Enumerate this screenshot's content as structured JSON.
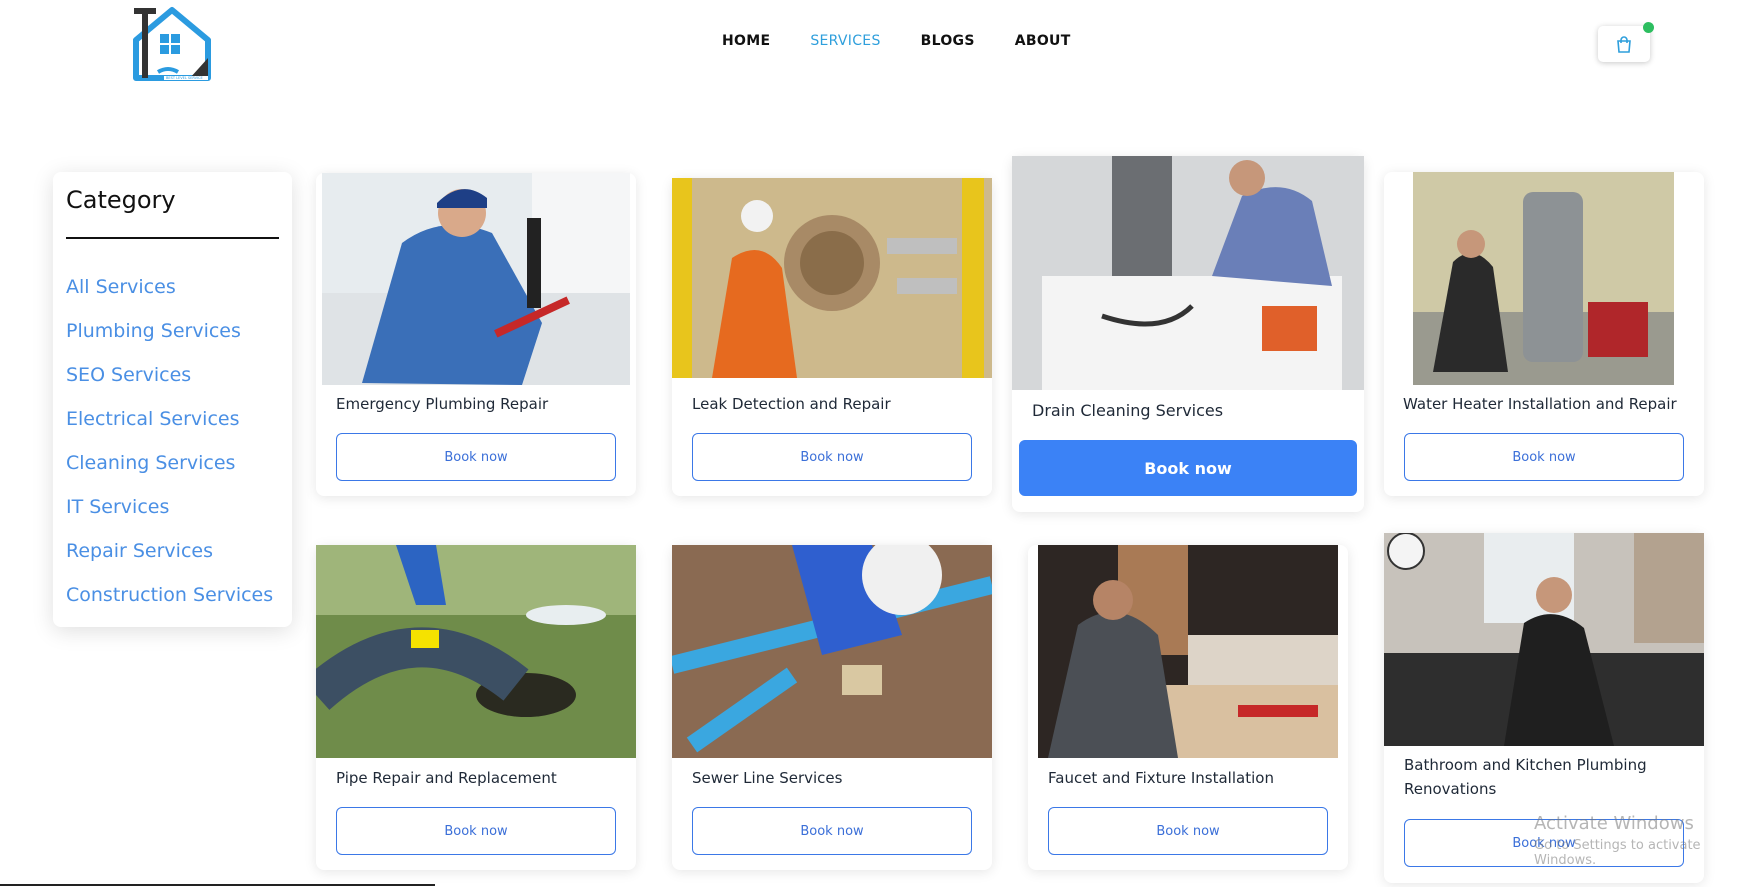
{
  "header": {
    "nav": [
      "HOME",
      "SERVICES",
      "BLOGS",
      "ABOUT"
    ],
    "active_nav": "SERVICES",
    "cart_icon": "shopping-bag-icon",
    "logo_text": "BEST LEVEL SERVICE"
  },
  "sidebar": {
    "title": "Category",
    "items": [
      "All Services",
      "Plumbing Services",
      "SEO Services",
      "Electrical Services",
      "Cleaning Services",
      "IT Services",
      "Repair Services",
      "Construction Services"
    ]
  },
  "services": [
    {
      "title": "Emergency Plumbing Repair",
      "button": "Book now"
    },
    {
      "title": "Leak Detection and Repair",
      "button": "Book now"
    },
    {
      "title": "Drain Cleaning Services",
      "button": "Book now"
    },
    {
      "title": "Water Heater Installation and Repair",
      "button": "Book now"
    },
    {
      "title": "Pipe Repair and Replacement",
      "button": "Book now"
    },
    {
      "title": "Sewer Line Services",
      "button": "Book now"
    },
    {
      "title": "Faucet and Fixture Installation",
      "button": "Book now"
    },
    {
      "title": "Bathroom and Kitchen Plumbing Renovations",
      "button": "Book now"
    }
  ],
  "watermark": {
    "line1": "Activate Windows",
    "line2": "Go to Settings to activate Windows."
  },
  "colors": {
    "accent": "#3b82f6",
    "link": "#4a8fe4",
    "active_nav": "#2f9fdc",
    "cart_badge": "#2dbe60"
  }
}
